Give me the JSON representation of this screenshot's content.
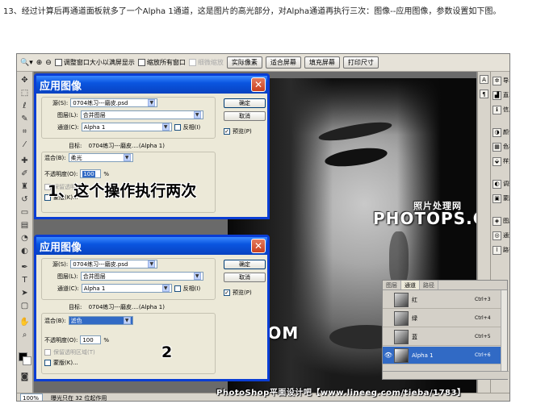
{
  "intro_text": "13、经过计算后再通道面板就多了一个Alpha 1通道，这是图片的高光部分，对Alpha通道再执行三次：图像--应用图像，参数设置如下图。",
  "optbar": {
    "buttons": [
      "实际像素",
      "适合屏幕",
      "填充屏幕",
      "打印尺寸"
    ],
    "checkboxes": [
      "调整窗口大小以满屏显示",
      "缩放所有窗口"
    ],
    "disabled_label": "细微缩放"
  },
  "dialog1": {
    "title": "应用图像",
    "source_label": "源(S):",
    "source_value": "0704练习---磨皮.psd",
    "layer_label": "图层(L):",
    "layer_value": "合并图层",
    "channel_label": "通道(C):",
    "channel_value": "Alpha 1",
    "invert_label": "反相(I)",
    "target_label": "目标:",
    "target_value": "0704练习---磨皮....(Alpha 1)",
    "blend_label": "混合(B):",
    "blend_value": "柔光",
    "opacity_label": "不透明度(O):",
    "opacity_value": "100",
    "opacity_unit": "%",
    "preserve_label": "保留透明区域",
    "mask_label": "蒙版(K)...",
    "ok": "确定",
    "cancel": "取消",
    "preview": "预览(P)",
    "annotation": "1、这个操作执行两次"
  },
  "dialog2": {
    "title": "应用图像",
    "source_label": "源(S):",
    "source_value": "0704练习---磨皮.psd",
    "layer_label": "图层(L):",
    "layer_value": "合并图层",
    "channel_label": "通道(C):",
    "channel_value": "Alpha 1",
    "invert_label": "反相(I)",
    "target_label": "目标:",
    "target_value": "0704练习---磨皮....(Alpha 1)",
    "blend_label": "混合(B):",
    "blend_value": "滤色",
    "opacity_label": "不透明度(O):",
    "opacity_value": "100",
    "opacity_unit": "%",
    "preserve_label": "保留透明区域(T)",
    "mask_label": "蒙版(K)...",
    "ok": "确定",
    "cancel": "取消",
    "preview": "预览(P)",
    "annotation": "2"
  },
  "watermark": {
    "cn": "照片处理网",
    "en": "PHOTOPS.COM"
  },
  "right_panel": [
    "导...",
    "直...",
    "信息",
    "颜色",
    "色板",
    "样式",
    "调整",
    "蒙版",
    "图层",
    "通道",
    "路径"
  ],
  "channels": {
    "tabs": [
      "图层",
      "通道",
      "路径"
    ],
    "rows": [
      {
        "name": "红",
        "shortcut": "Ctrl+3"
      },
      {
        "name": "绿",
        "shortcut": "Ctrl+4"
      },
      {
        "name": "蓝",
        "shortcut": "Ctrl+5"
      },
      {
        "name": "Alpha 1",
        "shortcut": "Ctrl+6"
      }
    ]
  },
  "status": {
    "zoom": "100%",
    "info": "曝光只在 32 位起作用"
  },
  "footer_watermark": "PhotoShop平面设计吧【www.lineeg.com/tieba/1783】"
}
